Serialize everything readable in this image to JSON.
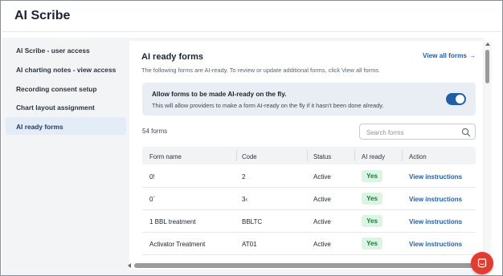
{
  "app": {
    "title": "AI Scribe"
  },
  "sidebar": {
    "items": [
      {
        "label": "AI Scribe - user access"
      },
      {
        "label": "AI charting notes - view access"
      },
      {
        "label": "Recording consent setup"
      },
      {
        "label": "Chart layout assignment"
      },
      {
        "label": "AI ready forms",
        "active": true
      }
    ]
  },
  "main": {
    "heading": "AI ready forms",
    "subtext": "The following forms are AI-ready. To review or update additional forms, click View all forms.",
    "view_all": "View all forms",
    "banner": {
      "title": "Allow forms to be made AI-ready on the fly.",
      "description": "This will allow providers to make a form AI-ready on the fly if it hasn't been done already.",
      "toggle_on": true
    },
    "count": "54 forms",
    "search": {
      "placeholder": "Search forms"
    },
    "table": {
      "columns": [
        "Form name",
        "Code",
        "Status",
        "AI ready",
        "Action"
      ],
      "rows": [
        {
          "name": "0!",
          "code": "2",
          "status": "Active",
          "ai_ready": "Yes",
          "action": "View instructions"
        },
        {
          "name": "0`",
          "code": "3‹",
          "status": "Active",
          "ai_ready": "Yes",
          "action": "View instructions"
        },
        {
          "name": "1 BBL treatment",
          "code": "BBLTC",
          "status": "Active",
          "ai_ready": "Yes",
          "action": "View instructions"
        },
        {
          "name": "Activator Treatment",
          "code": "AT01",
          "status": "Active",
          "ai_ready": "Yes",
          "action": "View instructions"
        }
      ]
    }
  },
  "colors": {
    "accent": "#1f5fa8",
    "badge_bg": "#ddf3e4",
    "badge_text": "#137a3a",
    "fab": "#e33b2e"
  }
}
